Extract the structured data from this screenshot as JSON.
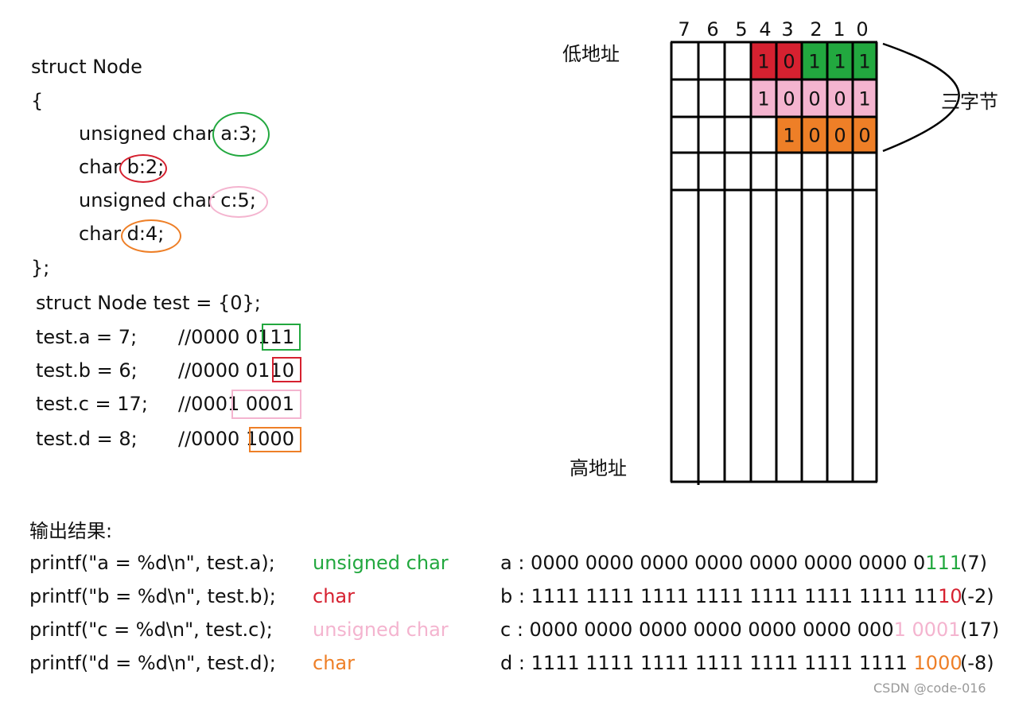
{
  "colors": {
    "green": "#22a83f",
    "red": "#d62130",
    "pink": "#f4b4cf",
    "orange": "#ee7f27"
  },
  "code": {
    "line1": "struct Node",
    "line2": "{",
    "a_decl": "unsigned char a:3;",
    "b_decl": "char b:2;",
    "c_decl": "unsigned char c:5;",
    "d_decl": "char d:4;",
    "close": "};",
    "init": "struct Node test = {0};",
    "asg": [
      {
        "stmt": "test.a = 7;",
        "comment": "//0000 0111"
      },
      {
        "stmt": "test.b = 6;",
        "comment": "//0000 0110"
      },
      {
        "stmt": "test.c = 17;",
        "comment": "//0001 0001"
      },
      {
        "stmt": "test.d = 8;",
        "comment": "//0000 1000"
      }
    ]
  },
  "memory": {
    "bit_headers": [
      "7",
      "6",
      "5",
      "4",
      "3",
      "2",
      "1",
      "0"
    ],
    "low_label": "低地址",
    "high_label": "高地址",
    "brace_label": "三字节",
    "rows": [
      [
        null,
        null,
        null,
        "1",
        "0",
        "1",
        "1",
        "1"
      ],
      [
        null,
        null,
        null,
        "1",
        "0",
        "0",
        "0",
        "1"
      ],
      [
        null,
        null,
        null,
        null,
        "1",
        "0",
        "0",
        "0"
      ],
      [
        null,
        null,
        null,
        null,
        null,
        null,
        null,
        null
      ]
    ],
    "row_colors": [
      [
        null,
        null,
        null,
        "red",
        "red",
        "green",
        "green",
        "green"
      ],
      [
        null,
        null,
        null,
        "pink",
        "pink",
        "pink",
        "pink",
        "pink"
      ],
      [
        null,
        null,
        null,
        null,
        "orange",
        "orange",
        "orange",
        "orange"
      ],
      [
        null,
        null,
        null,
        null,
        null,
        null,
        null,
        null
      ]
    ]
  },
  "output": {
    "title": "输出结果:",
    "rows": [
      {
        "call": "printf(\"a = %d\\n\", test.a);",
        "type": "unsigned char",
        "color": "green",
        "bits_black": "a : 0000 0000 0000 0000 0000 0000 0000 0",
        "bits_color": "111",
        "value": "(7)"
      },
      {
        "call": "printf(\"b = %d\\n\", test.b);",
        "type": "char",
        "color": "red",
        "bits_black": "b : 1111 1111 1111 1111 1111 1111 1111 11",
        "bits_color": "10",
        "value": "(-2)"
      },
      {
        "call": "printf(\"c = %d\\n\", test.c);",
        "type": "unsigned char",
        "color": "pink",
        "bits_black": "c : 0000 0000 0000 0000 0000 0000 000",
        "bits_color": "1 0001",
        "value": "(17)"
      },
      {
        "call": "printf(\"d = %d\\n\", test.d);",
        "type": "char",
        "color": "orange",
        "bits_black": "d : 1111 1111 1111 1111 1111 1111 1111 ",
        "bits_color": "1000",
        "value": "(-8)"
      }
    ]
  },
  "watermark": "CSDN @code-016"
}
